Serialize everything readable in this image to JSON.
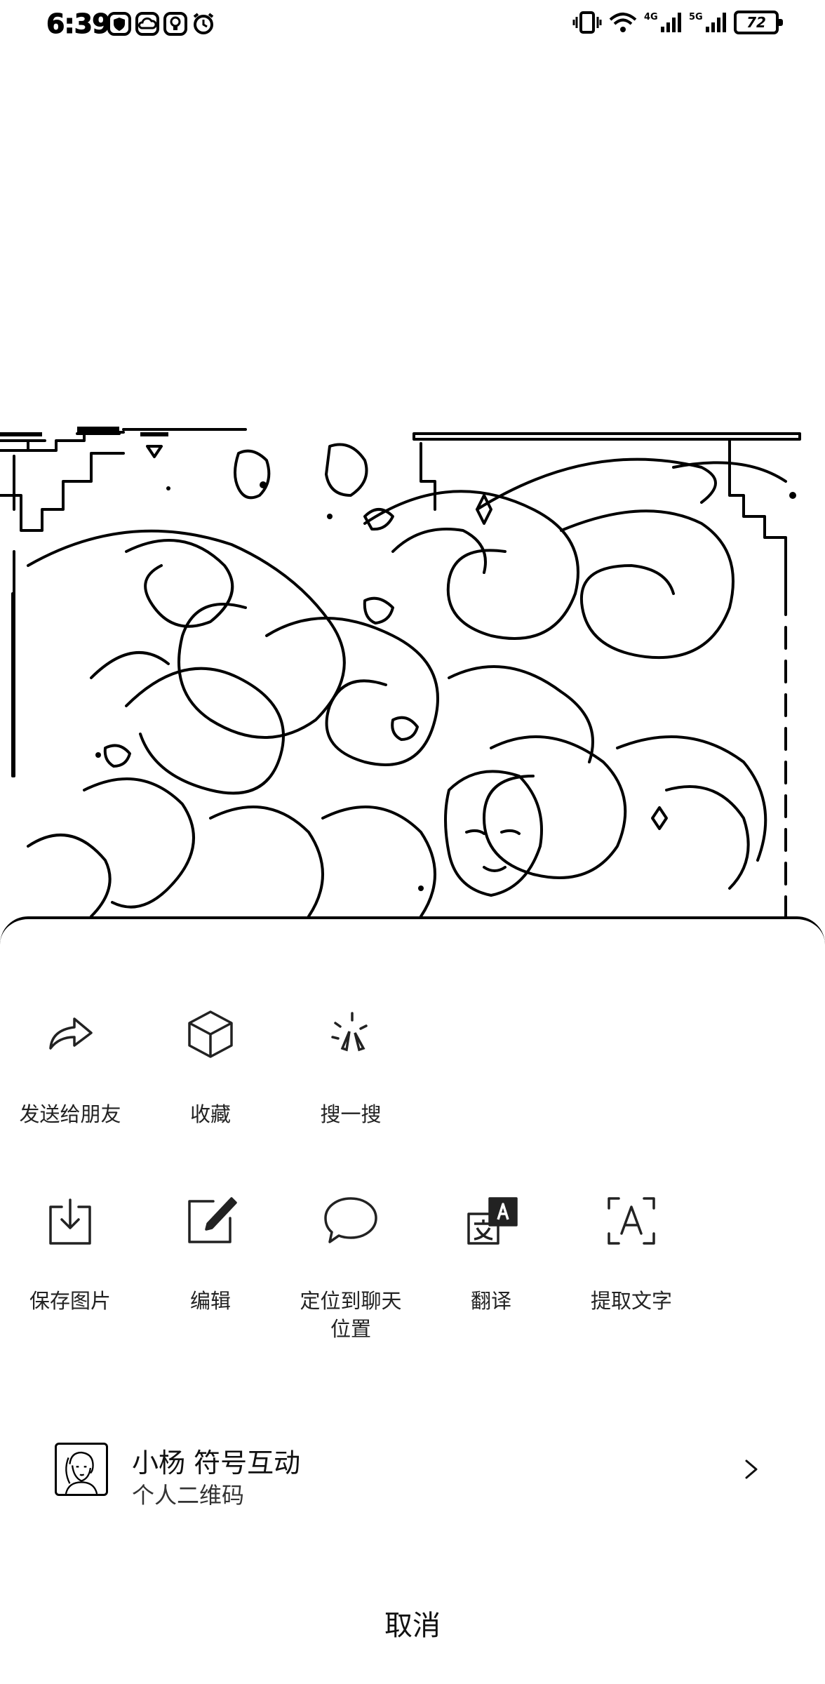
{
  "status_bar": {
    "time": "6:39",
    "battery": "72",
    "network_a": "4G",
    "network_b": "5G"
  },
  "share_sheet": {
    "primary_actions": [
      {
        "label": "发送给朋友",
        "icon": "share-forward-icon"
      },
      {
        "label": "收藏",
        "icon": "favorite-cube-icon"
      },
      {
        "label": "搜一搜",
        "icon": "search-sparkle-icon"
      }
    ],
    "secondary_actions": [
      {
        "label": "保存图片",
        "icon": "save-download-icon"
      },
      {
        "label": "编辑",
        "icon": "edit-pen-icon"
      },
      {
        "label": "定位到聊天\n位置",
        "icon": "chat-bubble-icon"
      },
      {
        "label": "翻译",
        "icon": "translate-icon"
      },
      {
        "label": "提取文字",
        "icon": "text-scan-icon"
      }
    ],
    "qr_code": {
      "name": "小杨 符号互动",
      "subtitle": "个人二维码"
    },
    "cancel_label": "取消"
  },
  "colors": {
    "background": "#ffffff",
    "foreground": "#000000"
  }
}
